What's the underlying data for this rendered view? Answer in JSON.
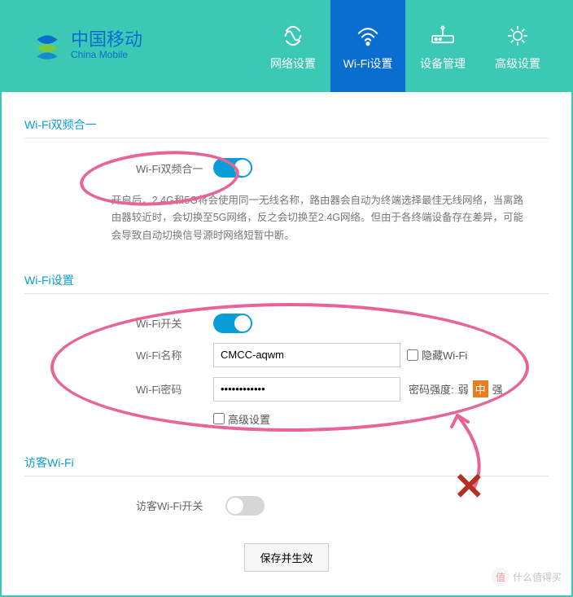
{
  "header": {
    "brand_cn": "中国移动",
    "brand_en": "China Mobile",
    "nav": [
      {
        "label": "网络设置",
        "icon": "network-icon"
      },
      {
        "label": "Wi-Fi设置",
        "icon": "wifi-icon"
      },
      {
        "label": "设备管理",
        "icon": "device-icon"
      },
      {
        "label": "高级设置",
        "icon": "advanced-icon"
      }
    ],
    "active_index": 1
  },
  "sections": {
    "dualband": {
      "title": "Wi-Fi双频合一",
      "toggle_label": "Wi-Fi双频合一",
      "toggle_on": true,
      "description": "开启后，2.4G和5G将会使用同一无线名称，路由器会自动为终端选择最佳无线网络，当离路由器较近时，会切换至5G网络，反之会切换至2.4G网络。但由于各终端设备存在差异，可能会导致自动切换信号源时网络短暂中断。"
    },
    "wifi": {
      "title": "Wi-Fi设置",
      "switch_label": "Wi-Fi开关",
      "switch_on": true,
      "name_label": "Wi-Fi名称",
      "name_value": "CMCC-aqwm",
      "hide_label": "隐藏Wi-Fi",
      "hide_checked": false,
      "pw_label": "Wi-Fi密码",
      "pw_value": "••••••••••••",
      "pw_strength_label": "密码强度:",
      "pw_levels": [
        "弱",
        "中",
        "强"
      ],
      "pw_active_level": 1,
      "advanced_label": "高级设置",
      "advanced_checked": false
    },
    "guest": {
      "title": "访客Wi-Fi",
      "switch_label": "访客Wi-Fi开关",
      "switch_on": false
    }
  },
  "save_button": "保存并生效",
  "watermark": "什么值得买"
}
